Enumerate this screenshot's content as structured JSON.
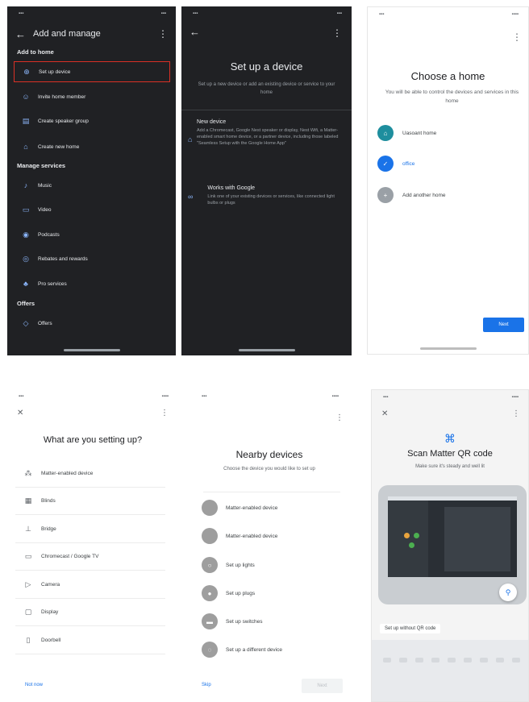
{
  "screen1": {
    "title": "Add and manage",
    "sections": {
      "add": "Add to home",
      "manage": "Manage services",
      "offers": "Offers"
    },
    "add_items": [
      {
        "label": "Set up device",
        "icon": "add-circle-icon"
      },
      {
        "label": "Invite home member",
        "icon": "person-add-icon"
      },
      {
        "label": "Create speaker group",
        "icon": "speaker-group-icon"
      },
      {
        "label": "Create new home",
        "icon": "home-icon"
      }
    ],
    "manage_items": [
      {
        "label": "Music",
        "icon": "music-note-icon"
      },
      {
        "label": "Video",
        "icon": "video-icon"
      },
      {
        "label": "Podcasts",
        "icon": "podcast-icon"
      },
      {
        "label": "Rebates and rewards",
        "icon": "rewards-icon"
      },
      {
        "label": "Pro services",
        "icon": "pro-services-icon"
      }
    ],
    "offer_items": [
      {
        "label": "Offers",
        "icon": "tag-icon"
      }
    ]
  },
  "screen2": {
    "title": "Set up a device",
    "subtitle": "Set up a new device or add an existing device or service to your home",
    "options": [
      {
        "title": "New device",
        "desc": "Add a Chromecast, Google Nest speaker or display, Nest Wifi, a Matter-enabled smart home device, or a partner device, including those labeled \"Seamless Setup with the Google Home App\"",
        "icon": "home-icon"
      },
      {
        "title": "Works with Google",
        "desc": "Link one of your existing devices or services, like connected light bulbs or plugs",
        "icon": "link-icon"
      }
    ]
  },
  "screen3": {
    "title": "Choose a home",
    "subtitle": "You will be able to control the devices and services in this home",
    "homes": [
      {
        "label": "Uasoant home",
        "icon": "home-icon",
        "color": "#1e8e9e"
      },
      {
        "label": "office",
        "icon": "check-icon",
        "color": "#1a73e8"
      },
      {
        "label": "Add another home",
        "icon": "plus-icon",
        "color": "#9aa0a6"
      }
    ],
    "next": "Next"
  },
  "screen4": {
    "title": "What are you setting up?",
    "items": [
      {
        "label": "Matter-enabled device",
        "icon": "matter-icon"
      },
      {
        "label": "Blinds",
        "icon": "blinds-icon"
      },
      {
        "label": "Bridge",
        "icon": "bridge-icon"
      },
      {
        "label": "Chromecast / Google TV",
        "icon": "tv-icon"
      },
      {
        "label": "Camera",
        "icon": "camera-icon"
      },
      {
        "label": "Display",
        "icon": "display-icon"
      },
      {
        "label": "Doorbell",
        "icon": "doorbell-icon"
      }
    ],
    "not_now": "Not now"
  },
  "screen5": {
    "title": "Nearby devices",
    "subtitle": "Choose the device you would like to set up",
    "items": [
      {
        "label": "Matter-enabled device",
        "icon": "device-icon"
      },
      {
        "label": "Matter-enabled device",
        "icon": "device-icon"
      },
      {
        "label": "Set up lights",
        "icon": "light-icon"
      },
      {
        "label": "Set up plugs",
        "icon": "plug-icon"
      },
      {
        "label": "Set up switches",
        "icon": "switch-icon"
      },
      {
        "label": "Set up a different device",
        "icon": "other-device-icon"
      }
    ],
    "skip": "Skip",
    "next": "Next"
  },
  "screen6": {
    "title": "Scan Matter QR code",
    "subtitle": "Make sure it's steady and well lit",
    "without_qr": "Set up without QR code"
  }
}
